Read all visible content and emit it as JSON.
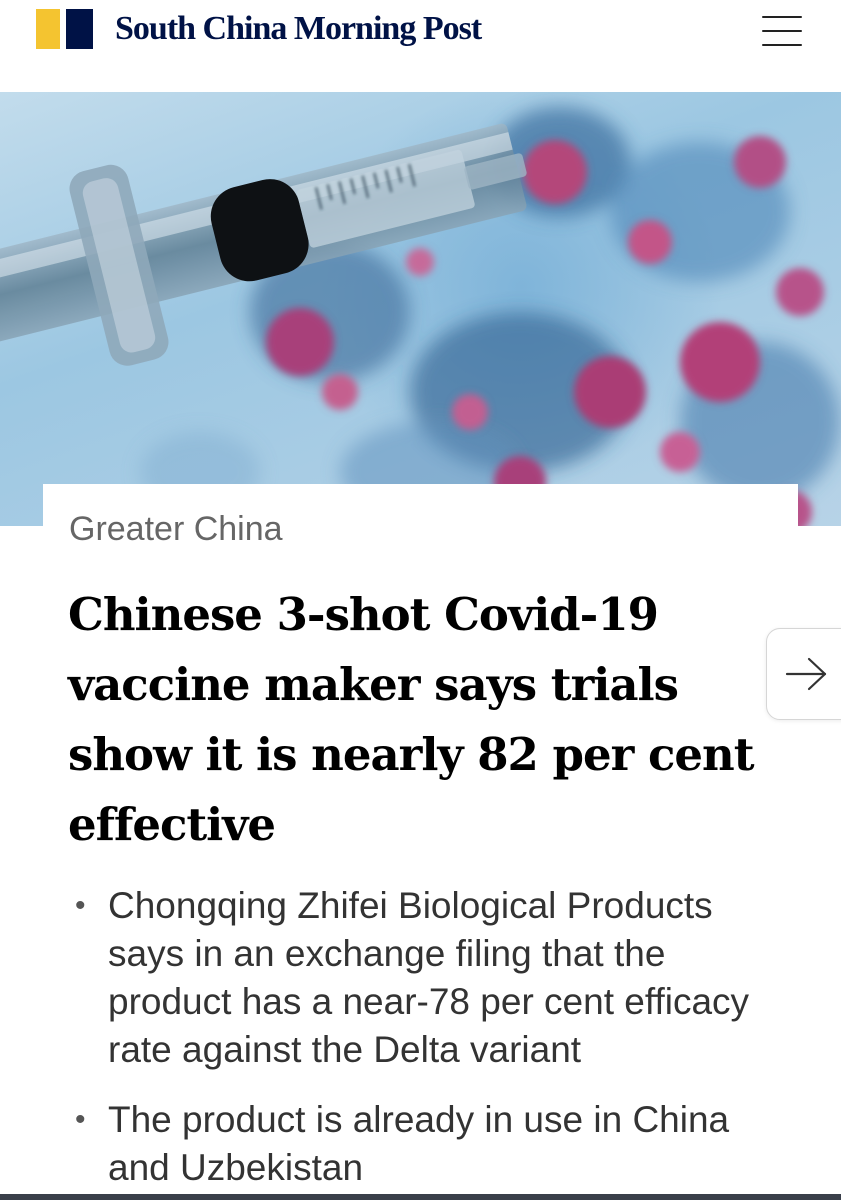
{
  "header": {
    "brand_name": "South China Morning Post",
    "brand_colors": {
      "yellow": "#f4c430",
      "navy": "#001246"
    },
    "menu_icon": "hamburger-menu-icon"
  },
  "hero": {
    "image_subject": "syringe and coronavirus particles"
  },
  "article": {
    "section": "Greater China",
    "headline": "Chinese 3-shot Covid-19 vaccine maker says trials show it is nearly 82 per cent effective",
    "bullets": [
      "Chongqing Zhifei Biological Products says in an exchange filing that the product has a near-78 per cent efficacy rate against the Delta variant",
      "The product is already in use in China and Uzbekistan"
    ]
  },
  "navigation": {
    "next_icon": "arrow-right-icon"
  }
}
